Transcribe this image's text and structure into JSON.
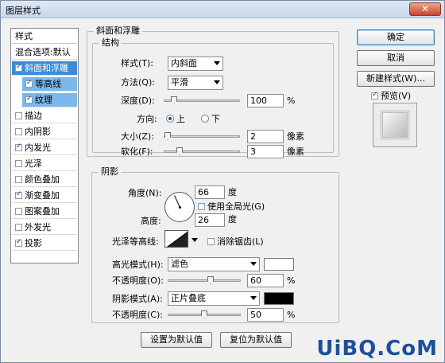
{
  "window": {
    "title": "图层样式",
    "close_icon": "close-icon"
  },
  "style_list": {
    "items": [
      {
        "label": "样式",
        "checkbox": false,
        "checked": false
      },
      {
        "label": "混合选项:默认",
        "checkbox": false,
        "checked": false
      },
      {
        "label": "斜面和浮雕",
        "checkbox": true,
        "checked": true
      },
      {
        "label": "等高线",
        "checkbox": true,
        "checked": true
      },
      {
        "label": "纹理",
        "checkbox": true,
        "checked": true
      },
      {
        "label": "描边",
        "checkbox": true,
        "checked": false
      },
      {
        "label": "内阴影",
        "checkbox": true,
        "checked": false
      },
      {
        "label": "内发光",
        "checkbox": true,
        "checked": true
      },
      {
        "label": "光泽",
        "checkbox": true,
        "checked": false
      },
      {
        "label": "颜色叠加",
        "checkbox": true,
        "checked": false
      },
      {
        "label": "渐变叠加",
        "checkbox": true,
        "checked": true
      },
      {
        "label": "图案叠加",
        "checkbox": true,
        "checked": false
      },
      {
        "label": "外发光",
        "checkbox": true,
        "checked": false
      },
      {
        "label": "投影",
        "checkbox": true,
        "checked": true
      }
    ]
  },
  "bevel": {
    "group_title": "斜面和浮雕",
    "structure_title": "结构",
    "style_label": "样式(T):",
    "style_value": "内斜面",
    "technique_label": "方法(Q):",
    "technique_value": "平滑",
    "depth_label": "深度(D):",
    "depth_value": "100",
    "depth_unit": "%",
    "depth_fraction": 0.1,
    "direction_label": "方向:",
    "dir_up": "上",
    "dir_down": "下",
    "size_label": "大小(Z):",
    "size_value": "2",
    "size_unit": "像素",
    "size_fraction": 0.01,
    "soften_label": "软化(F):",
    "soften_value": "3",
    "soften_unit": "像素",
    "soften_fraction": 0.18
  },
  "shading": {
    "group_title": "阴影",
    "angle_label": "角度(N):",
    "angle_value": "66",
    "angle_unit": "度",
    "global_light_label": "使用全局光(G)",
    "altitude_label": "高度:",
    "altitude_value": "26",
    "altitude_unit": "度",
    "gloss_label": "光泽等高线:",
    "antialias_label": "消除锯齿(L)",
    "highlight_label": "高光模式(H):",
    "highlight_value": "滤色",
    "highlight_color": "#ffffff",
    "highlight_opacity_label": "不透明度(O):",
    "highlight_opacity_value": "60",
    "highlight_opacity_unit": "%",
    "highlight_opacity_fraction": 0.6,
    "shadow_label": "阴影模式(A):",
    "shadow_value": "正片叠底",
    "shadow_color": "#000000",
    "shadow_opacity_label": "不透明度(C):",
    "shadow_opacity_value": "50",
    "shadow_opacity_unit": "%",
    "shadow_opacity_fraction": 0.5
  },
  "footer": {
    "set_default": "设置为默认值",
    "reset_default": "复位为默认值"
  },
  "buttons": {
    "ok": "确定",
    "cancel": "取消",
    "new_style": "新建样式(W)...",
    "preview_label": "预览(V)"
  },
  "watermark": "UiBQ.CoM"
}
